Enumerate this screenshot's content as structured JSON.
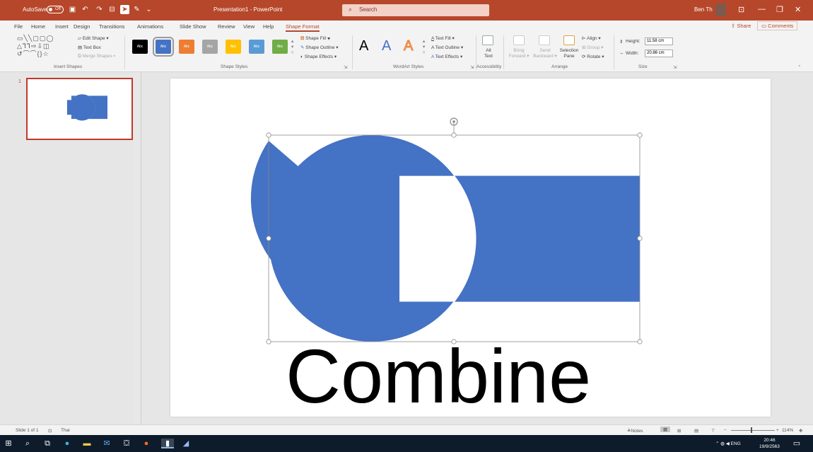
{
  "titlebar": {
    "autosave_label": "AutoSave",
    "autosave_state": "Off",
    "title": "Presentation1 - PowerPoint",
    "search_placeholder": "Search",
    "user": "Ben Th"
  },
  "tabs": [
    "File",
    "Home",
    "Insert",
    "Design",
    "Transitions",
    "Animations",
    "Slide Show",
    "Review",
    "View",
    "Help",
    "Shape Format"
  ],
  "active_tab": "Shape Format",
  "share_label": "Share",
  "comments_label": "Comments",
  "ribbon": {
    "insert_shapes": {
      "edit_shape": "Edit Shape",
      "text_box": "Text Box",
      "merge_shapes": "Merge Shapes",
      "label": "Insert Shapes"
    },
    "shape_styles": {
      "style_label": "Abc",
      "colors": [
        "#000000",
        "#4472c4",
        "#ed7d31",
        "#a5a5a5",
        "#ffc000",
        "#5b9bd5",
        "#70ad47"
      ],
      "shape_fill": "Shape Fill",
      "shape_outline": "Shape Outline",
      "shape_effects": "Shape Effects",
      "label": "Shape Styles"
    },
    "wordart": {
      "letter": "A",
      "text_fill": "Text Fill",
      "text_outline": "Text Outline",
      "text_effects": "Text Effects",
      "label": "WordArt Styles"
    },
    "accessibility": {
      "alt_text_1": "Alt",
      "alt_text_2": "Text",
      "label": "Accessibility"
    },
    "arrange": {
      "bring_forward_1": "Bring",
      "bring_forward_2": "Forward",
      "send_backward_1": "Send",
      "send_backward_2": "Backward",
      "selection_pane_1": "Selection",
      "selection_pane_2": "Pane",
      "align": "Align",
      "group": "Group",
      "rotate": "Rotate",
      "label": "Arrange"
    },
    "size": {
      "height_label": "Height:",
      "height_value": "11.58 cm",
      "width_label": "Width:",
      "width_value": "20.86 cm",
      "label": "Size"
    }
  },
  "slides_panel": {
    "slide_number": "1"
  },
  "slide": {
    "shape_color": "#4472c4",
    "caption": "Combine"
  },
  "statusbar": {
    "slide_info": "Slide 1 of 1",
    "language": "Thai",
    "notes": "Notes",
    "zoom": "114%"
  },
  "taskbar": {
    "lang": "ENG",
    "time": "20:46",
    "date": "19/9/2563"
  }
}
